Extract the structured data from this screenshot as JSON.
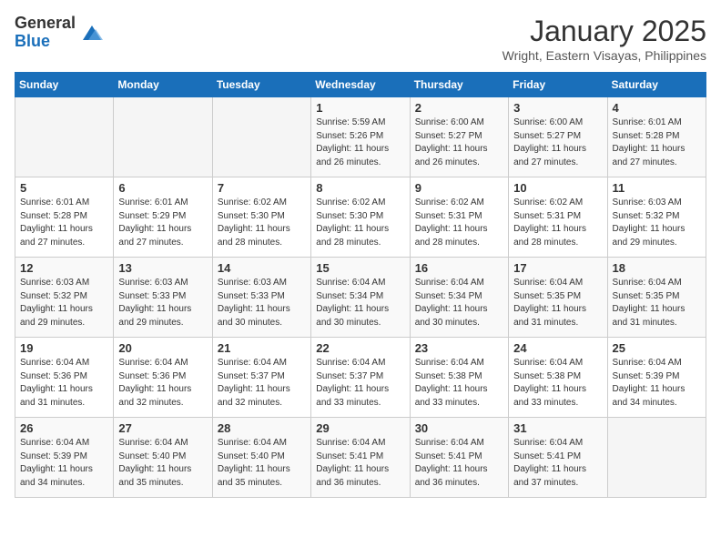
{
  "logo": {
    "general": "General",
    "blue": "Blue"
  },
  "title": "January 2025",
  "subtitle": "Wright, Eastern Visayas, Philippines",
  "days_header": [
    "Sunday",
    "Monday",
    "Tuesday",
    "Wednesday",
    "Thursday",
    "Friday",
    "Saturday"
  ],
  "weeks": [
    [
      {
        "day": "",
        "info": ""
      },
      {
        "day": "",
        "info": ""
      },
      {
        "day": "",
        "info": ""
      },
      {
        "day": "1",
        "info": "Sunrise: 5:59 AM\nSunset: 5:26 PM\nDaylight: 11 hours and 26 minutes."
      },
      {
        "day": "2",
        "info": "Sunrise: 6:00 AM\nSunset: 5:27 PM\nDaylight: 11 hours and 26 minutes."
      },
      {
        "day": "3",
        "info": "Sunrise: 6:00 AM\nSunset: 5:27 PM\nDaylight: 11 hours and 27 minutes."
      },
      {
        "day": "4",
        "info": "Sunrise: 6:01 AM\nSunset: 5:28 PM\nDaylight: 11 hours and 27 minutes."
      }
    ],
    [
      {
        "day": "5",
        "info": "Sunrise: 6:01 AM\nSunset: 5:28 PM\nDaylight: 11 hours and 27 minutes."
      },
      {
        "day": "6",
        "info": "Sunrise: 6:01 AM\nSunset: 5:29 PM\nDaylight: 11 hours and 27 minutes."
      },
      {
        "day": "7",
        "info": "Sunrise: 6:02 AM\nSunset: 5:30 PM\nDaylight: 11 hours and 28 minutes."
      },
      {
        "day": "8",
        "info": "Sunrise: 6:02 AM\nSunset: 5:30 PM\nDaylight: 11 hours and 28 minutes."
      },
      {
        "day": "9",
        "info": "Sunrise: 6:02 AM\nSunset: 5:31 PM\nDaylight: 11 hours and 28 minutes."
      },
      {
        "day": "10",
        "info": "Sunrise: 6:02 AM\nSunset: 5:31 PM\nDaylight: 11 hours and 28 minutes."
      },
      {
        "day": "11",
        "info": "Sunrise: 6:03 AM\nSunset: 5:32 PM\nDaylight: 11 hours and 29 minutes."
      }
    ],
    [
      {
        "day": "12",
        "info": "Sunrise: 6:03 AM\nSunset: 5:32 PM\nDaylight: 11 hours and 29 minutes."
      },
      {
        "day": "13",
        "info": "Sunrise: 6:03 AM\nSunset: 5:33 PM\nDaylight: 11 hours and 29 minutes."
      },
      {
        "day": "14",
        "info": "Sunrise: 6:03 AM\nSunset: 5:33 PM\nDaylight: 11 hours and 30 minutes."
      },
      {
        "day": "15",
        "info": "Sunrise: 6:04 AM\nSunset: 5:34 PM\nDaylight: 11 hours and 30 minutes."
      },
      {
        "day": "16",
        "info": "Sunrise: 6:04 AM\nSunset: 5:34 PM\nDaylight: 11 hours and 30 minutes."
      },
      {
        "day": "17",
        "info": "Sunrise: 6:04 AM\nSunset: 5:35 PM\nDaylight: 11 hours and 31 minutes."
      },
      {
        "day": "18",
        "info": "Sunrise: 6:04 AM\nSunset: 5:35 PM\nDaylight: 11 hours and 31 minutes."
      }
    ],
    [
      {
        "day": "19",
        "info": "Sunrise: 6:04 AM\nSunset: 5:36 PM\nDaylight: 11 hours and 31 minutes."
      },
      {
        "day": "20",
        "info": "Sunrise: 6:04 AM\nSunset: 5:36 PM\nDaylight: 11 hours and 32 minutes."
      },
      {
        "day": "21",
        "info": "Sunrise: 6:04 AM\nSunset: 5:37 PM\nDaylight: 11 hours and 32 minutes."
      },
      {
        "day": "22",
        "info": "Sunrise: 6:04 AM\nSunset: 5:37 PM\nDaylight: 11 hours and 33 minutes."
      },
      {
        "day": "23",
        "info": "Sunrise: 6:04 AM\nSunset: 5:38 PM\nDaylight: 11 hours and 33 minutes."
      },
      {
        "day": "24",
        "info": "Sunrise: 6:04 AM\nSunset: 5:38 PM\nDaylight: 11 hours and 33 minutes."
      },
      {
        "day": "25",
        "info": "Sunrise: 6:04 AM\nSunset: 5:39 PM\nDaylight: 11 hours and 34 minutes."
      }
    ],
    [
      {
        "day": "26",
        "info": "Sunrise: 6:04 AM\nSunset: 5:39 PM\nDaylight: 11 hours and 34 minutes."
      },
      {
        "day": "27",
        "info": "Sunrise: 6:04 AM\nSunset: 5:40 PM\nDaylight: 11 hours and 35 minutes."
      },
      {
        "day": "28",
        "info": "Sunrise: 6:04 AM\nSunset: 5:40 PM\nDaylight: 11 hours and 35 minutes."
      },
      {
        "day": "29",
        "info": "Sunrise: 6:04 AM\nSunset: 5:41 PM\nDaylight: 11 hours and 36 minutes."
      },
      {
        "day": "30",
        "info": "Sunrise: 6:04 AM\nSunset: 5:41 PM\nDaylight: 11 hours and 36 minutes."
      },
      {
        "day": "31",
        "info": "Sunrise: 6:04 AM\nSunset: 5:41 PM\nDaylight: 11 hours and 37 minutes."
      },
      {
        "day": "",
        "info": ""
      }
    ]
  ]
}
